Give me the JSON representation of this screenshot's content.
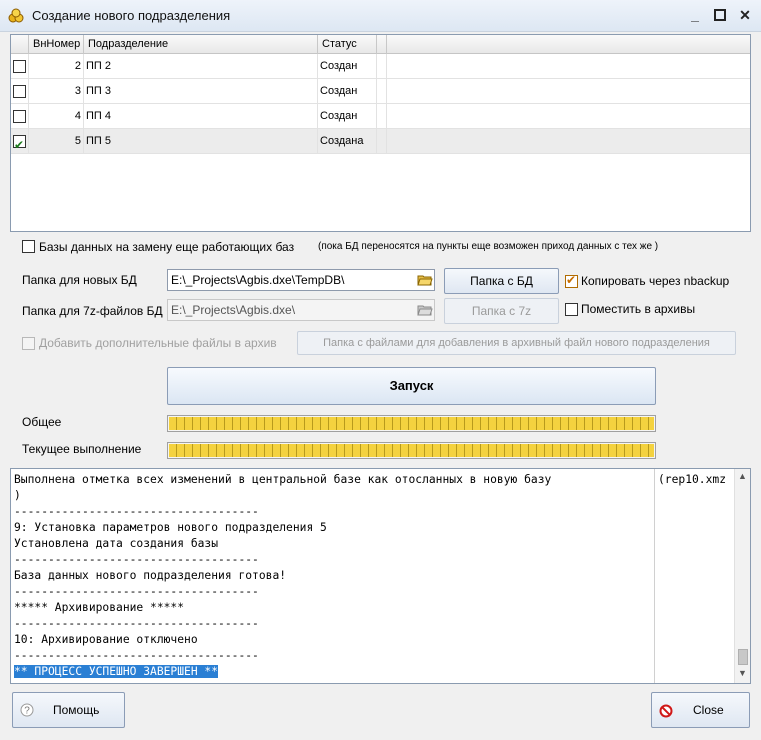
{
  "window": {
    "title": "Создание нового подразделения"
  },
  "grid": {
    "columns": [
      "ВнНомер",
      "Подразделение",
      "Статус"
    ],
    "rows": [
      {
        "checked": false,
        "num": "2",
        "name": "ПП 2",
        "status": "Создан"
      },
      {
        "checked": false,
        "num": "3",
        "name": "ПП 3",
        "status": "Создан"
      },
      {
        "checked": false,
        "num": "4",
        "name": "ПП 4",
        "status": "Создан"
      },
      {
        "checked": true,
        "num": "5",
        "name": "ПП 5",
        "status": "Создана"
      }
    ]
  },
  "options": {
    "replace_db_label": "Базы данных на замену еще работающих баз",
    "replace_db_note": "(пока БД переносятся на пункты еще возможен приход данных с тех же )",
    "new_db_folder_label": "Папка для новых БД",
    "new_db_folder_value": "E:\\_Projects\\Agbis.dxe\\TempDB\\",
    "folder_db_button": "Папка с БД",
    "copy_nbackup_label": "Копировать через nbackup",
    "zip_folder_label": "Папка для 7z-файлов БД",
    "zip_folder_value": "E:\\_Projects\\Agbis.dxe\\",
    "folder_7z_button": "Папка с 7z",
    "archive_label": "Поместить в архивы",
    "extra_files_label": "Добавить дополнительные файлы в архив",
    "extra_files_button": "Папка с файлами для добавления в архивный файл нового подразделения"
  },
  "run_button": "Запуск",
  "progress": {
    "overall_label": "Общее",
    "overall_fraction": 1.0,
    "current_label": "Текущее выполнение",
    "current_fraction": 1.0
  },
  "log": {
    "lines": [
      "Выполнена отметка всех изменений в центральной базе как отосланных в новую базу",
      ")",
      "------------------------------------",
      "9: Установка параметров нового подразделения 5",
      "Установлена дата создания базы",
      "------------------------------------",
      "База данных нового подразделения готова!",
      "------------------------------------",
      "***** Архивирование *****",
      "------------------------------------",
      "10: Архивирование отключено",
      "------------------------------------"
    ],
    "highlighted": "** ПРОЦЕСС УСПЕШНО ЗАВЕРШЕН **",
    "overflow": "(rep10.xmz"
  },
  "buttons": {
    "help": "Помощь",
    "close": "Close"
  }
}
